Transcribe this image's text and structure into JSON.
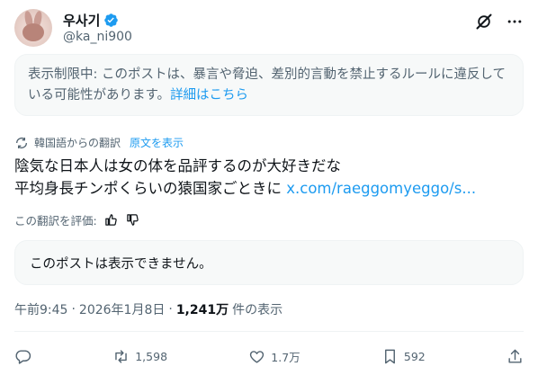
{
  "author": {
    "display_name": "우사기",
    "handle": "@ka_ni900"
  },
  "notice": {
    "text": "表示制限中: このポストは、暴言や脅迫、差別的言動を禁止するルールに違反している可能性があります。",
    "link": "詳細はこちら"
  },
  "translation": {
    "label": "韓国語からの翻訳",
    "show_original": "原文を表示"
  },
  "post": {
    "line1": "陰気な日本人は女の体を品評するのが大好きだな",
    "line2": "平均身長チンポくらいの猿国家ごときに",
    "url": "x.com/raeggomyeggo/s..."
  },
  "rate_translation": "この翻訳を評価:",
  "quoted": {
    "text": "このポストは表示できません。"
  },
  "meta": {
    "time": "午前9:45",
    "separator": "·",
    "date": "2026年1月8日",
    "views_count": "1,241万",
    "views_label": "件の表示"
  },
  "actions": {
    "reposts": "1,598",
    "likes": "1.7万",
    "bookmarks": "592"
  },
  "colors": {
    "accent": "#1d9bf0",
    "muted": "#536471",
    "text": "#0f1419",
    "panel": "#f7f9f9"
  },
  "icons": [
    "verified-badge-icon",
    "grok-icon",
    "more-icon",
    "translate-icon",
    "thumbs-up-icon",
    "thumbs-down-icon",
    "reply-icon",
    "repost-icon",
    "like-icon",
    "bookmark-icon",
    "share-icon"
  ]
}
